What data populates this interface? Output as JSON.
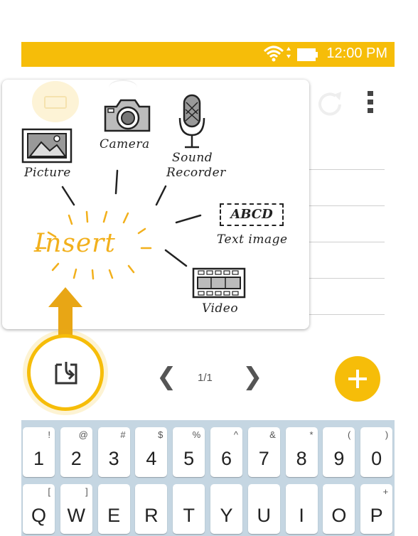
{
  "status_bar": {
    "time": "12:00 PM",
    "wifi_icon": "wifi-icon",
    "battery_icon": "battery-icon",
    "color": "#f6bd09"
  },
  "toolbar": {
    "icons": [
      "keyboard-icon",
      "handwriting-icon",
      "undo-icon",
      "redo-icon",
      "more-icon"
    ]
  },
  "insert_popup": {
    "title": "Insert",
    "items": [
      {
        "label": "Picture",
        "icon": "picture-icon"
      },
      {
        "label": "Camera",
        "icon": "camera-icon"
      },
      {
        "label": "Sound",
        "label2": "Recorder",
        "icon": "microphone-icon"
      },
      {
        "label": "Text image",
        "icon": "text-image-icon",
        "sample": "ABCD"
      },
      {
        "label": "Video",
        "icon": "video-film-icon"
      }
    ]
  },
  "bottom": {
    "page_indicator": "1/1",
    "prev": "❮",
    "next": "❯",
    "insert_icon": "insert-icon",
    "add_icon": "plus-icon"
  },
  "keyboard": {
    "row1": [
      {
        "main": "1",
        "sub": "!"
      },
      {
        "main": "2",
        "sub": "@"
      },
      {
        "main": "3",
        "sub": "#"
      },
      {
        "main": "4",
        "sub": "$"
      },
      {
        "main": "5",
        "sub": "%"
      },
      {
        "main": "6",
        "sub": "^"
      },
      {
        "main": "7",
        "sub": "&"
      },
      {
        "main": "8",
        "sub": "*"
      },
      {
        "main": "9",
        "sub": "("
      },
      {
        "main": "0",
        "sub": ")"
      }
    ],
    "row2": [
      {
        "main": "Q",
        "sub": "["
      },
      {
        "main": "W",
        "sub": "]"
      },
      {
        "main": "E",
        "sub": ""
      },
      {
        "main": "R",
        "sub": ""
      },
      {
        "main": "T",
        "sub": ""
      },
      {
        "main": "Y",
        "sub": ""
      },
      {
        "main": "U",
        "sub": ""
      },
      {
        "main": "I",
        "sub": ""
      },
      {
        "main": "O",
        "sub": ""
      },
      {
        "main": "P",
        "sub": "+"
      }
    ]
  }
}
